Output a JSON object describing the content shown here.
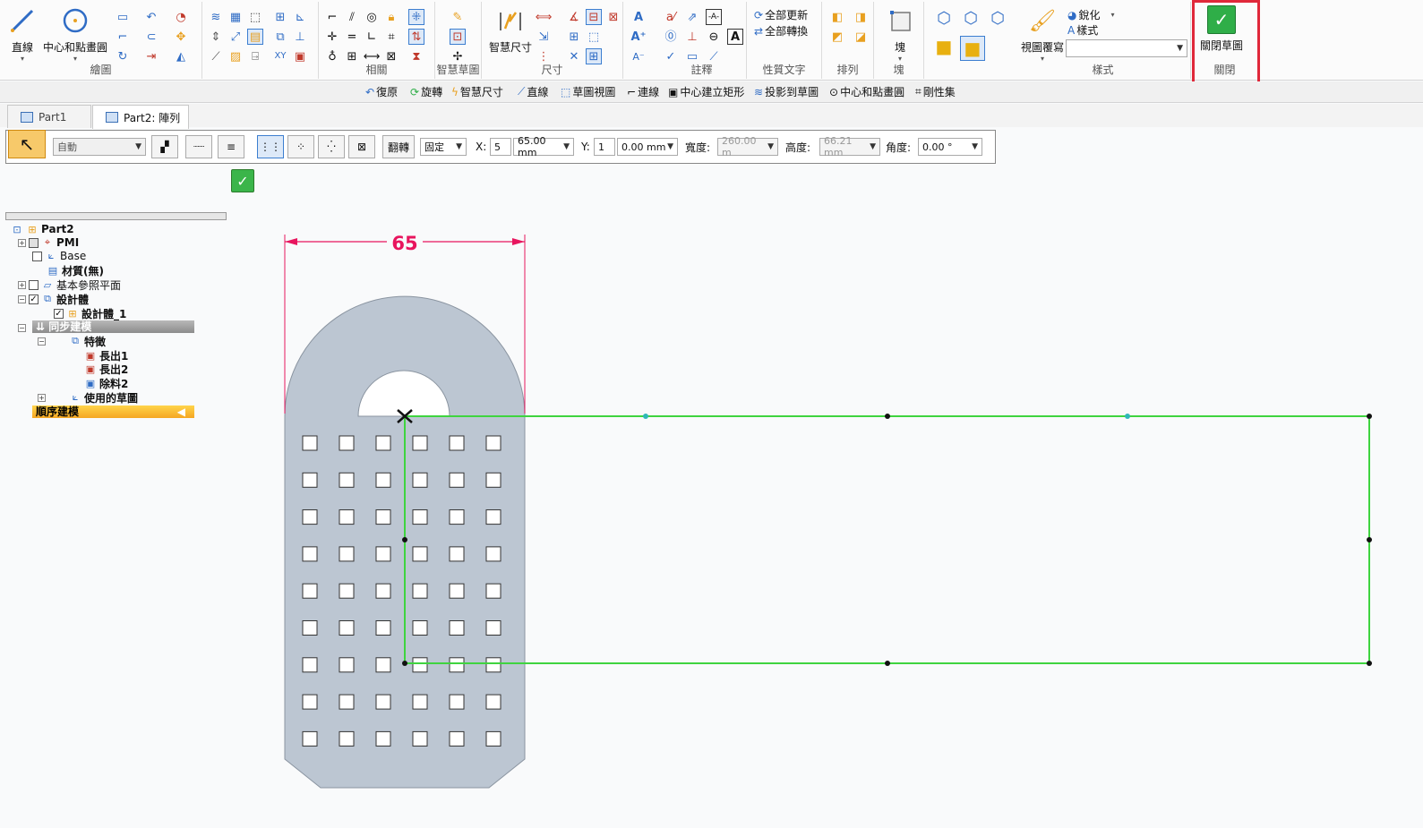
{
  "ribbon": {
    "draw": {
      "line_label": "直線",
      "center_circle_label": "中心和點畫圓",
      "group_label": "繪圖"
    },
    "relate": {
      "group_label": "相關"
    },
    "intellisketch": {
      "group_label": "智慧草圖"
    },
    "dimension": {
      "smart_dim_label": "智慧尺寸",
      "group_label": "尺寸"
    },
    "annotation": {
      "group_label": "註釋"
    },
    "property_text": {
      "update_all": "全部更新",
      "convert_all": "全部轉換",
      "group_label": "性質文字"
    },
    "arrange": {
      "group_label": "排列"
    },
    "block": {
      "block_label": "塊",
      "group_label": "塊"
    },
    "style": {
      "sharpen": "銳化",
      "style": "樣式",
      "view_override": "視圖覆寫",
      "group_label": "樣式",
      "combo_value": ""
    },
    "close": {
      "close_sketch_label": "關閉草圖",
      "group_label": "關閉"
    }
  },
  "command_bar": {
    "items": [
      "復原",
      "旋轉",
      "智慧尺寸",
      "直線",
      "草圖視圖",
      "連線",
      "中心建立矩形",
      "投影到草圖",
      "中心和點畫圓",
      "剛性集"
    ]
  },
  "tabs": [
    {
      "label": "Part1",
      "active": false
    },
    {
      "label": "Part2: 陣列",
      "active": true
    }
  ],
  "property_bar": {
    "mode_combo": "自動",
    "flip_label": "翻轉",
    "lock_combo": "固定",
    "x_label": "X:",
    "x_count": "5",
    "x_value": "65.00 mm",
    "y_label": "Y:",
    "y_count": "1",
    "y_value": "0.00 mm",
    "width_label": "寬度:",
    "width_value": "260.00 m",
    "height_label": "高度:",
    "height_value": "66.21 mm",
    "angle_label": "角度:",
    "angle_value": "0.00 °"
  },
  "tree": {
    "root": "Part2",
    "pmi": "PMI",
    "base": "Base",
    "material": "材質(無)",
    "ref_planes": "基本參照平面",
    "design_body": "設計體",
    "design_body_1": "設計體_1",
    "sync_modeling": "同步建模",
    "features": "特徵",
    "protrude1": "長出1",
    "protrude2": "長出2",
    "cutout2": "除料2",
    "used_sketches": "使用的草圖",
    "ordered_modeling": "順序建模"
  },
  "drawing": {
    "dimension_value": "65"
  },
  "colors": {
    "dimension": "#e8155e",
    "sketch_green": "#3fd43f",
    "part_fill": "#bcc6d2",
    "highlight_red": "#e0283a"
  }
}
